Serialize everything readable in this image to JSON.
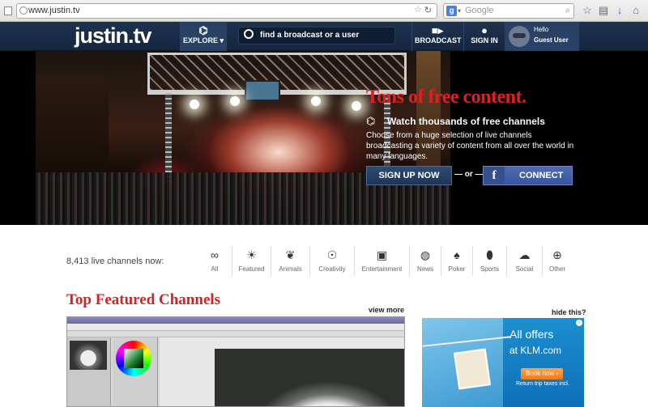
{
  "browser": {
    "url": "www.justin.tv",
    "search_placeholder": "Google"
  },
  "header": {
    "logo": "justin.tv",
    "explore_label": "EXPLORE",
    "search_placeholder": "find a broadcast or a user",
    "broadcast_label": "BROADCAST",
    "signin_label": "SIGN IN",
    "hello": "Hello",
    "guest": "Guest User"
  },
  "hero": {
    "title": "Tons of free content.",
    "subtitle": "Watch thousands of free channels",
    "description": "Choose from a huge selection of live channels broadcasting a variety of content from all over the world in many languages.",
    "signup_label": "SIGN UP NOW",
    "or_label": "— or —",
    "connect_label": "CONNECT",
    "fb_letter": "f"
  },
  "categories": {
    "live_count": "8,413 live channels now:",
    "items": [
      {
        "label": "All",
        "icon": "infinity-icon",
        "glyph": "∞"
      },
      {
        "label": "Featured",
        "icon": "sun-icon",
        "glyph": "☀"
      },
      {
        "label": "Animals",
        "icon": "paws-icon",
        "glyph": "❦"
      },
      {
        "label": "Creativity",
        "icon": "lightbulb-icon",
        "glyph": "☉"
      },
      {
        "label": "Entertainment",
        "icon": "clapperboard-icon",
        "glyph": "▣"
      },
      {
        "label": "News",
        "icon": "globe-icon",
        "glyph": "◍"
      },
      {
        "label": "Poker",
        "icon": "cards-icon",
        "glyph": "♠"
      },
      {
        "label": "Sports",
        "icon": "football-icon",
        "glyph": "⬮"
      },
      {
        "label": "Social",
        "icon": "chat-icon",
        "glyph": "☁"
      },
      {
        "label": "Other",
        "icon": "plus-circle-icon",
        "glyph": "⊕"
      }
    ]
  },
  "featured": {
    "title": "Top Featured Channels",
    "view_more": "view more",
    "hide_this": "hide this?"
  },
  "ad": {
    "line1": "All offers",
    "line2": "at KLM.com",
    "button": "Book now ›",
    "small": "Return trip taxes incl."
  }
}
